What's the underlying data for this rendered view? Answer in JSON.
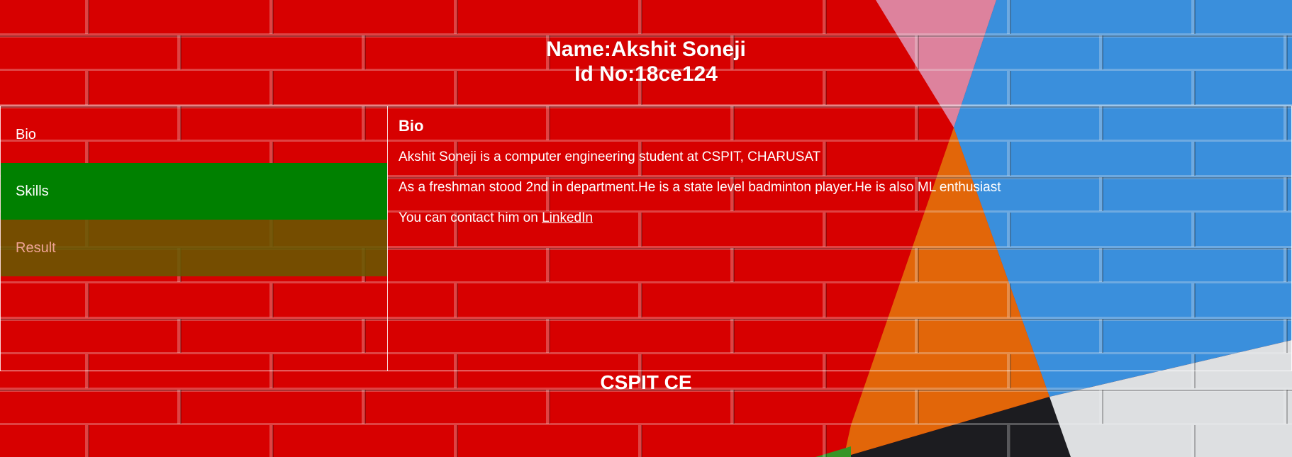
{
  "header": {
    "name_line": "Name:Akshit Soneji",
    "id_line": "Id No:18ce124"
  },
  "nav": {
    "items": [
      {
        "label": "Bio"
      },
      {
        "label": "Skills"
      },
      {
        "label": "Result"
      }
    ]
  },
  "content": {
    "heading": "Bio",
    "line1": "Akshit Soneji is a computer engineering student at CSPIT, CHARUSAT",
    "line2": "As a freshman stood 2nd in department.He is a state level badminton player.He is also ML enthusiast",
    "contact_prefix": "You can contact him on ",
    "contact_link": "LinkedIn"
  },
  "footer": {
    "text": "CSPIT CE"
  },
  "colors": {
    "brick_red": "#e30000",
    "brick_blue": "#3e97e8",
    "brick_orange": "#ef6c0a",
    "brick_pink": "#e98aa6",
    "skills_active": "#008000",
    "result_bg": "#645a00"
  }
}
